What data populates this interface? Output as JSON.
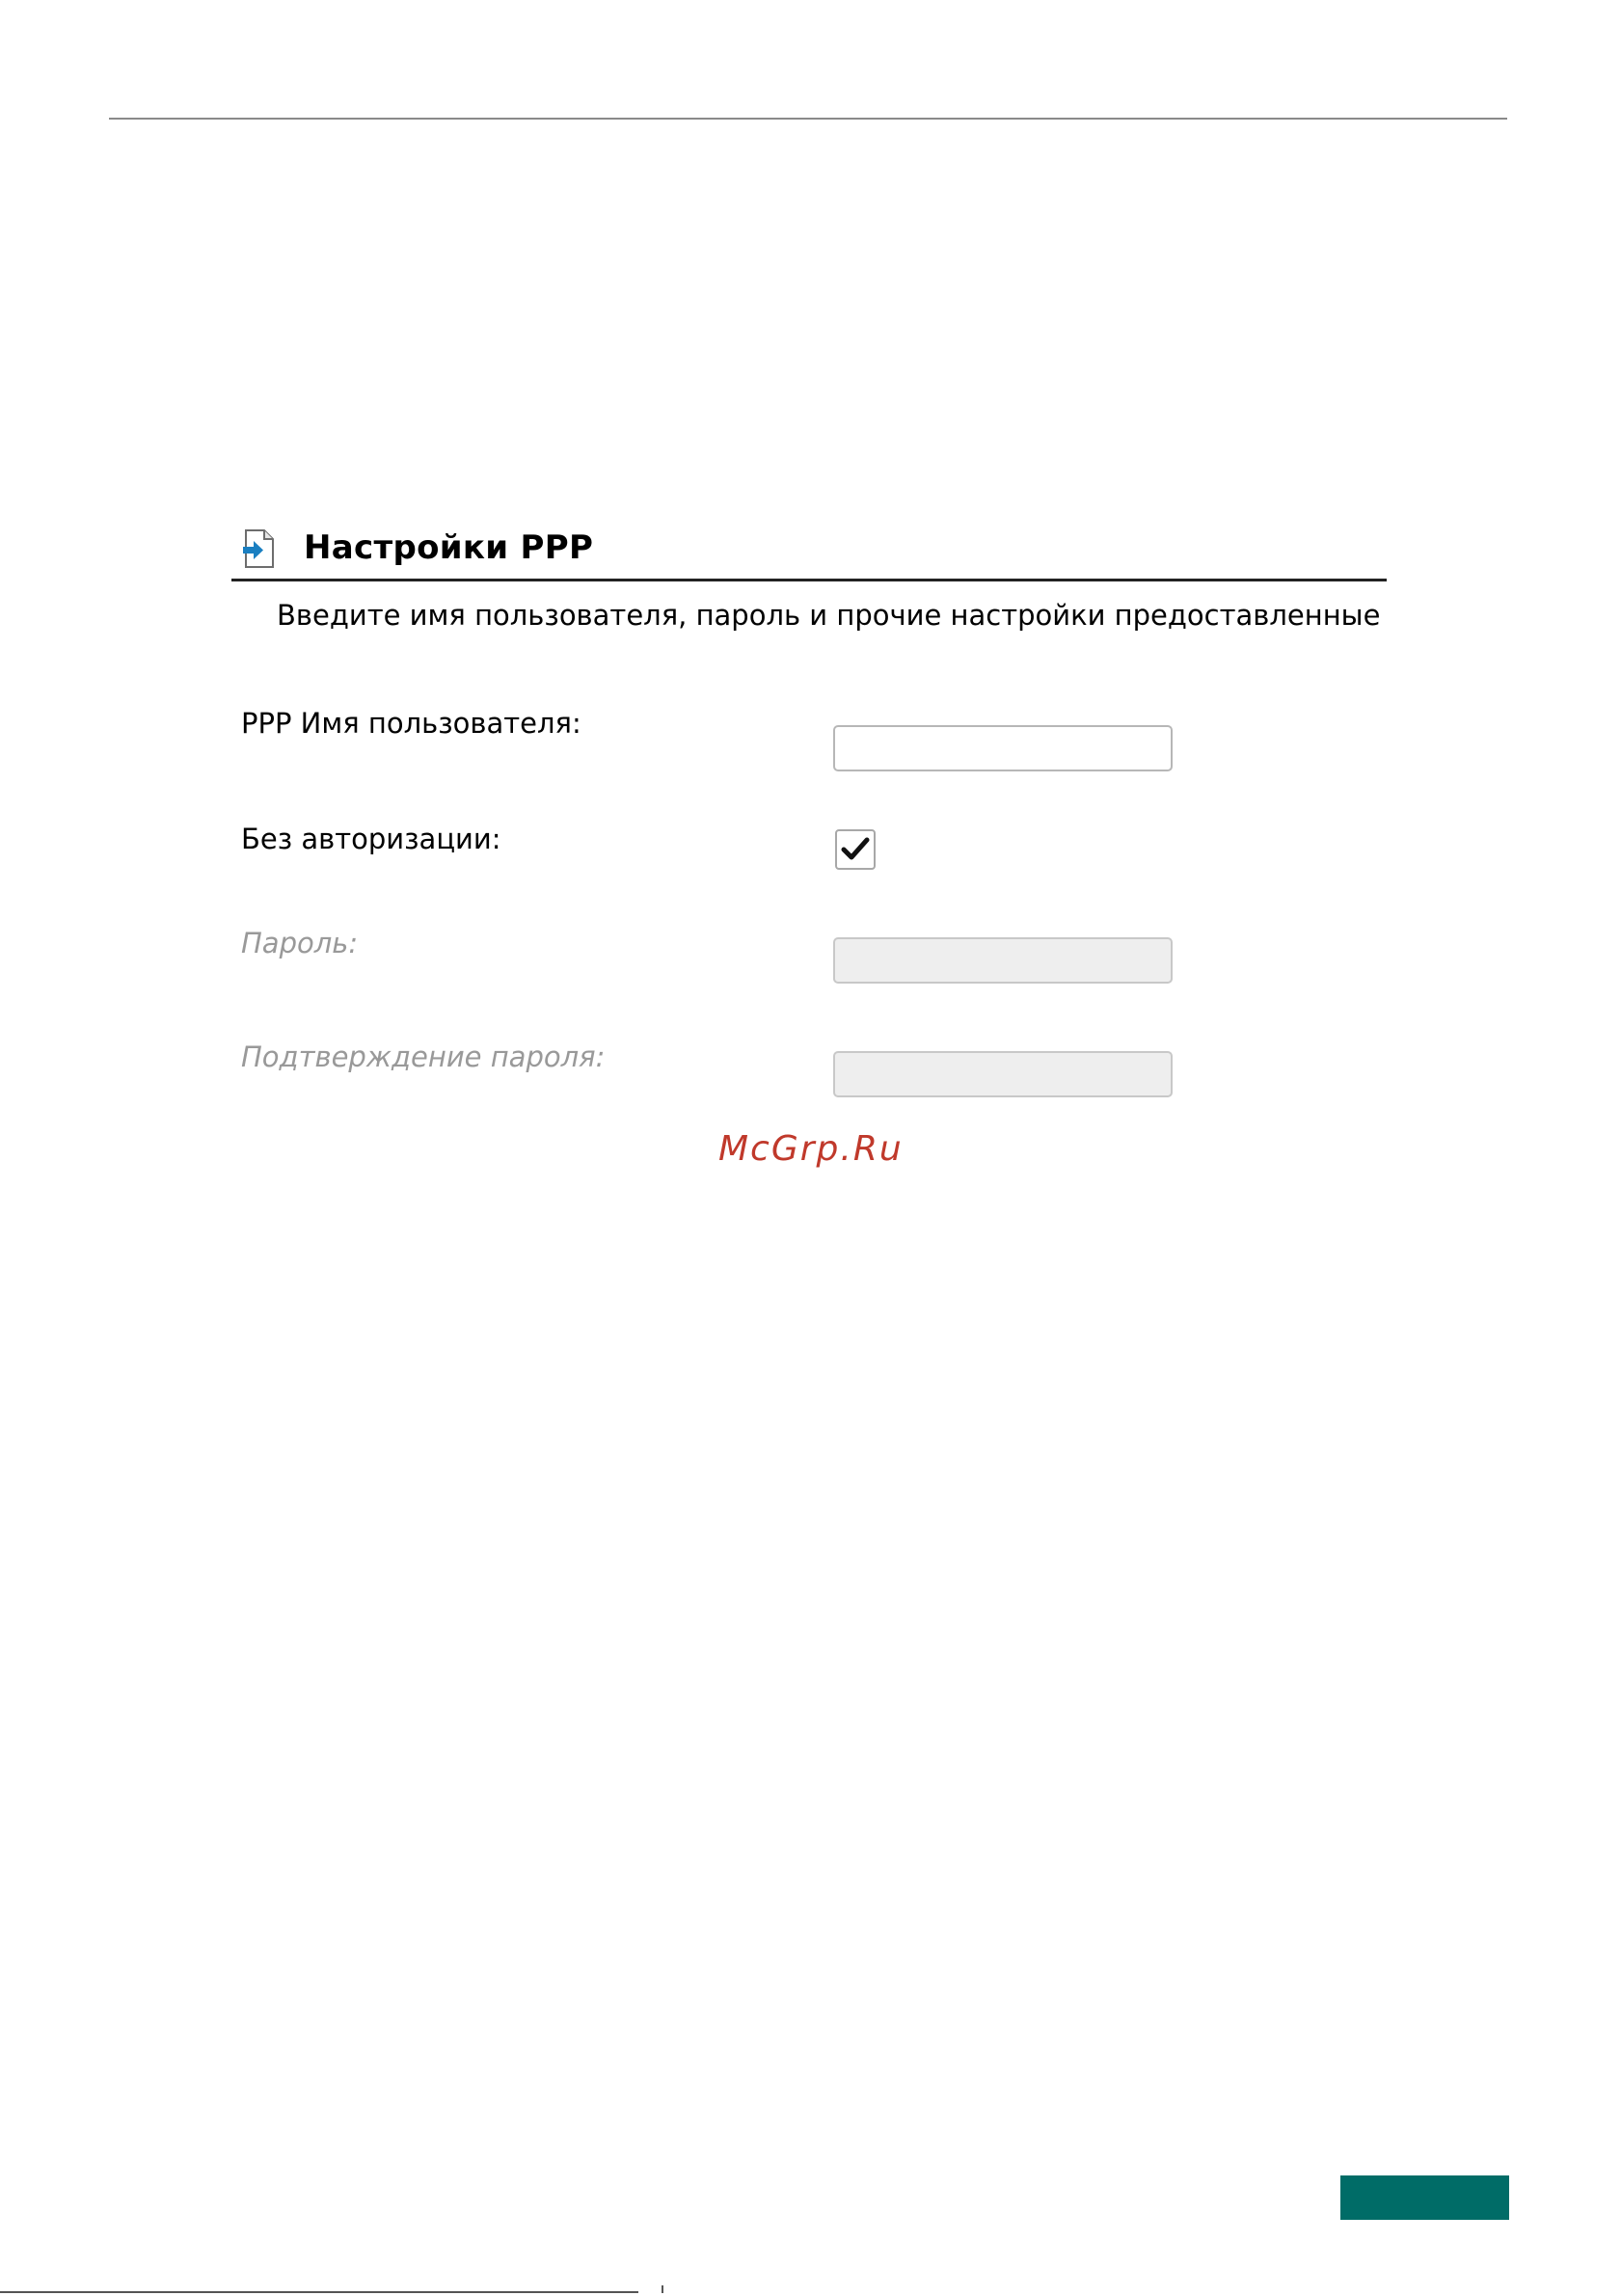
{
  "section": {
    "title": "Настройки PPP",
    "icon": "page-arrow-icon",
    "instructions": "Введите имя пользователя, пароль и прочие настройки предоставленные"
  },
  "form": {
    "username_label": "PPP Имя пользователя:",
    "username_value": "",
    "no_auth_label": "Без авторизации:",
    "no_auth_checked": true,
    "password_label": "Пароль:",
    "password_value": "",
    "password_confirm_label": "Подтверждение пароля:",
    "password_confirm_value": ""
  },
  "watermark": "McGrp.Ru",
  "colors": {
    "accent": "#006c67",
    "watermark": "#c0392b",
    "disabled_text": "#999999",
    "icon_arrow": "#1a7fc1"
  }
}
